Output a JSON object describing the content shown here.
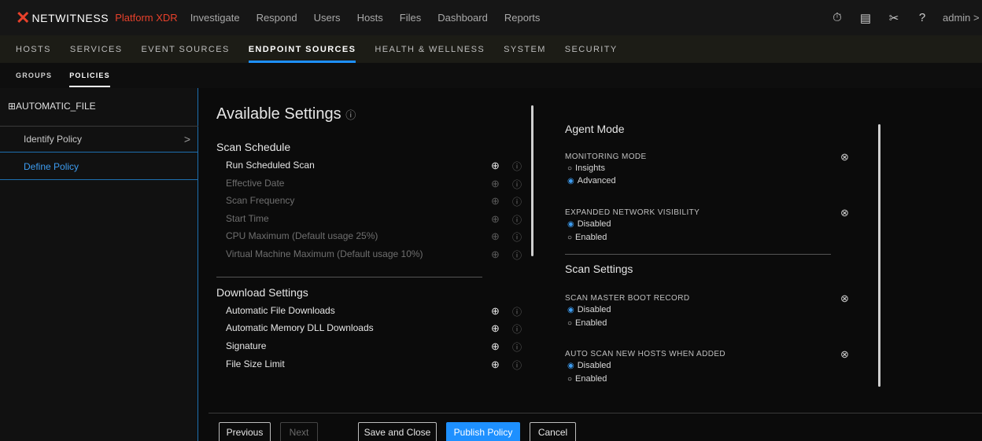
{
  "topbar": {
    "brand_mark": "✕",
    "brand_name": "NETWITNESS",
    "product": "Platform XDR",
    "nav": [
      "Investigate",
      "Respond",
      "Users",
      "Hosts",
      "Files",
      "Dashboard",
      "Reports"
    ],
    "icons": [
      "timer-icon",
      "notes-icon",
      "tools-icon",
      "help-icon"
    ],
    "user": "admin >"
  },
  "subnav": {
    "items": [
      "HOSTS",
      "SERVICES",
      "EVENT SOURCES",
      "ENDPOINT SOURCES",
      "HEALTH & WELLNESS",
      "SYSTEM",
      "SECURITY"
    ],
    "active": "ENDPOINT SOURCES"
  },
  "tertnav": {
    "items": [
      "GROUPS",
      "POLICIES"
    ],
    "active": "POLICIES"
  },
  "leftpanel": {
    "policy_name": "⊞AUTOMATIC_FILE",
    "steps": [
      {
        "label": "Identify Policy"
      },
      {
        "label": "Define Policy"
      }
    ]
  },
  "available": {
    "title": "Available Settings",
    "scan_schedule": {
      "heading": "Scan Schedule",
      "rows": [
        {
          "label": "Run Scheduled Scan",
          "enabled": true
        },
        {
          "label": "Effective Date",
          "enabled": false
        },
        {
          "label": "Scan Frequency",
          "enabled": false
        },
        {
          "label": "Start Time",
          "enabled": false
        },
        {
          "label": "CPU Maximum (Default usage 25%)",
          "enabled": false
        },
        {
          "label": "Virtual Machine Maximum (Default usage 10%)",
          "enabled": false
        }
      ]
    },
    "download_settings": {
      "heading": "Download Settings",
      "rows": [
        {
          "label": "Automatic File Downloads",
          "enabled": true
        },
        {
          "label": "Automatic Memory DLL Downloads",
          "enabled": true
        },
        {
          "label": "Signature",
          "enabled": true
        },
        {
          "label": "File Size Limit",
          "enabled": true
        }
      ]
    }
  },
  "selected": {
    "agent_mode": {
      "heading": "Agent Mode",
      "monitoring_mode": {
        "label": "MONITORING MODE",
        "options": [
          "Insights",
          "Advanced"
        ],
        "selected": "Advanced"
      },
      "expanded_network": {
        "label": "EXPANDED NETWORK VISIBILITY",
        "options": [
          "Disabled",
          "Enabled"
        ],
        "selected": "Disabled"
      }
    },
    "scan_settings": {
      "heading": "Scan Settings",
      "mbr": {
        "label": "SCAN MASTER BOOT RECORD",
        "options": [
          "Disabled",
          "Enabled"
        ],
        "selected": "Disabled"
      },
      "auto_scan": {
        "label": "AUTO SCAN NEW HOSTS WHEN ADDED",
        "options": [
          "Disabled",
          "Enabled"
        ],
        "selected": "Disabled"
      }
    }
  },
  "footer": {
    "previous": "Previous",
    "next": "Next",
    "save": "Save and Close",
    "publish": "Publish Policy",
    "cancel": "Cancel"
  },
  "colors": {
    "accent": "#1e90ff",
    "brand": "#e8412b"
  }
}
